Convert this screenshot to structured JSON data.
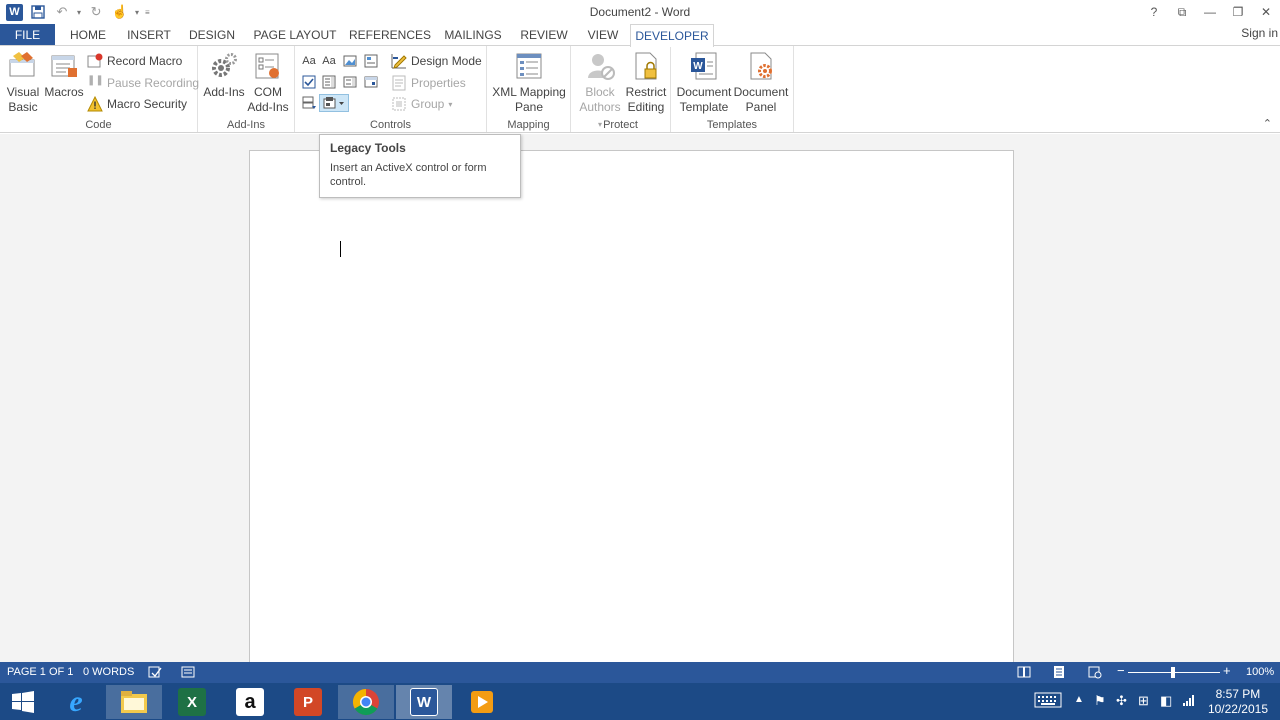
{
  "window": {
    "title": "Document2 - Word",
    "controls": {
      "help": "?",
      "options": "⧉",
      "minimize": "—",
      "restore": "❐",
      "close": "✕"
    }
  },
  "quick_access": {
    "logo": "W",
    "save": "save-icon",
    "undo": "undo-icon",
    "redo": "redo-icon",
    "touch": "touch-mode-icon"
  },
  "tabs": [
    "FILE",
    "HOME",
    "INSERT",
    "DESIGN",
    "PAGE LAYOUT",
    "REFERENCES",
    "MAILINGS",
    "REVIEW",
    "VIEW",
    "DEVELOPER"
  ],
  "active_tab": "DEVELOPER",
  "sign_in": "Sign in",
  "ribbon": {
    "code": {
      "label": "Code",
      "visual_basic": [
        "Visual",
        "Basic"
      ],
      "macros": "Macros",
      "record_macro": "Record Macro",
      "pause_recording": "Pause Recording",
      "macro_security": "Macro Security"
    },
    "addins": {
      "label": "Add-Ins",
      "addins": "Add-Ins",
      "com_addins": [
        "COM",
        "Add-Ins"
      ]
    },
    "controls": {
      "label": "Controls",
      "rich_text_glyph": "Aa",
      "plain_text_glyph": "Aa",
      "design_mode": "Design Mode",
      "properties": "Properties",
      "group": "Group"
    },
    "mapping": {
      "label": "Mapping",
      "xml_mapping_pane": [
        "XML Mapping",
        "Pane"
      ]
    },
    "protect": {
      "label": "Protect",
      "block_authors": [
        "Block",
        "Authors"
      ],
      "restrict_editing": [
        "Restrict",
        "Editing"
      ]
    },
    "templates": {
      "label": "Templates",
      "document_template": [
        "Document",
        "Template"
      ],
      "document_panel": [
        "Document",
        "Panel"
      ]
    }
  },
  "tooltip": {
    "title": "Legacy Tools",
    "body": "Insert an ActiveX control or form control."
  },
  "status": {
    "page": "PAGE 1 OF 1",
    "words": "0 WORDS",
    "zoom": "100%",
    "zoom_level": 1.0
  },
  "taskbar": {
    "apps": [
      "start",
      "internet-explorer",
      "file-explorer",
      "excel",
      "amazon",
      "powerpoint",
      "chrome",
      "word",
      "media-player"
    ],
    "active_app": "word",
    "time": "8:57 PM",
    "date": "10/22/2015"
  },
  "colors": {
    "accent": "#2b579a",
    "taskbar": "#1c4a86",
    "tooltip_highlight": "#cde6f7"
  }
}
